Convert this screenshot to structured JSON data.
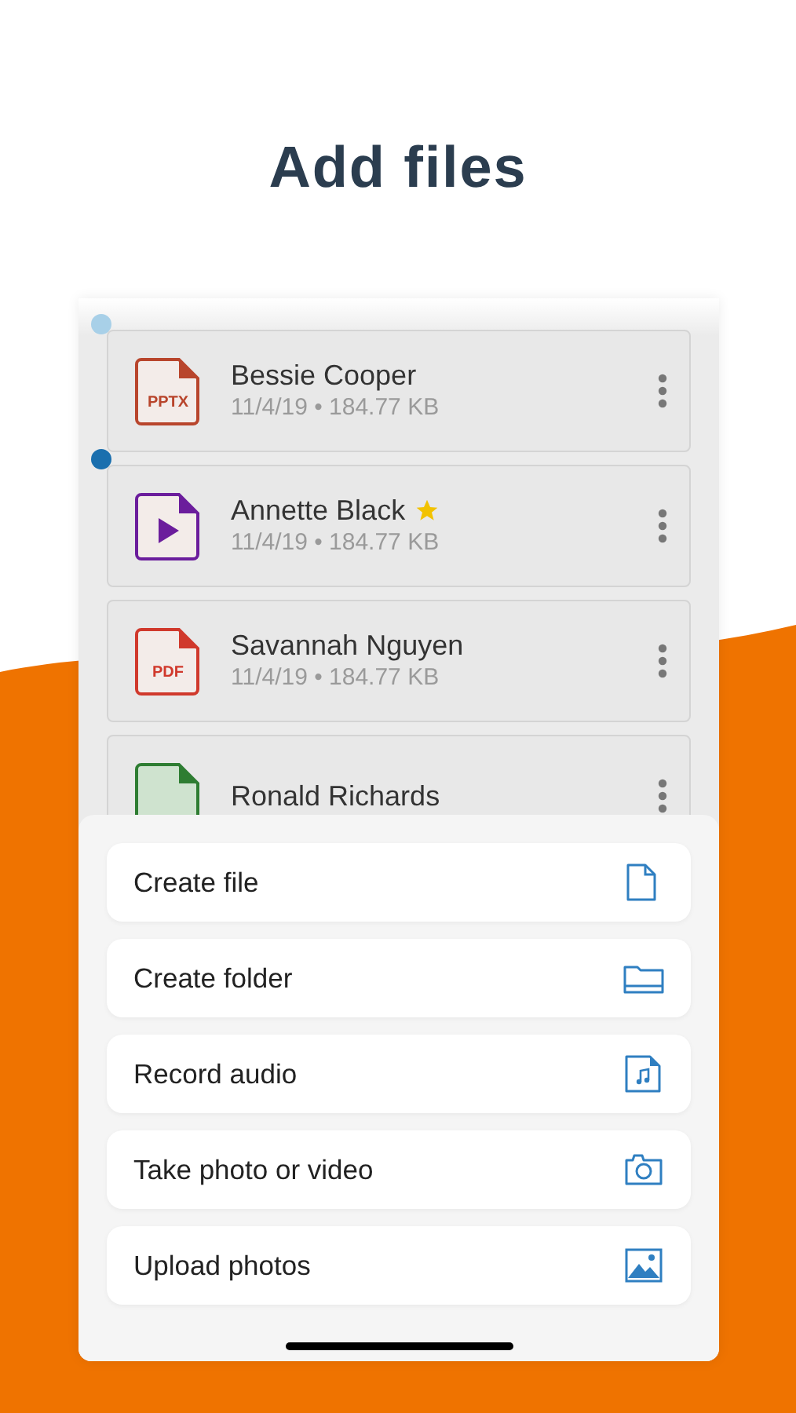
{
  "title": "Add files",
  "files": [
    {
      "name": "Bessie Cooper",
      "meta": "11/4/19 • 184.77 KB",
      "kind": "pptx",
      "icon_label": "PPTX",
      "starred": false,
      "color": "#a8d0e8"
    },
    {
      "name": "Annette Black",
      "meta": "11/4/19 • 184.77 KB",
      "kind": "video",
      "starred": true,
      "color": "#1a6fae"
    },
    {
      "name": "Savannah Nguyen",
      "meta": "11/4/19 • 184.77 KB",
      "kind": "pdf",
      "icon_label": "PDF",
      "starred": false
    },
    {
      "name": "Ronald Richards",
      "kind": "sheet",
      "starred": false
    }
  ],
  "actions": [
    {
      "label": "Create file",
      "kind": "file"
    },
    {
      "label": "Create folder",
      "kind": "folder"
    },
    {
      "label": "Record audio",
      "kind": "audio"
    },
    {
      "label": "Take photo or video",
      "kind": "camera"
    },
    {
      "label": "Upload photos",
      "kind": "photos"
    }
  ]
}
